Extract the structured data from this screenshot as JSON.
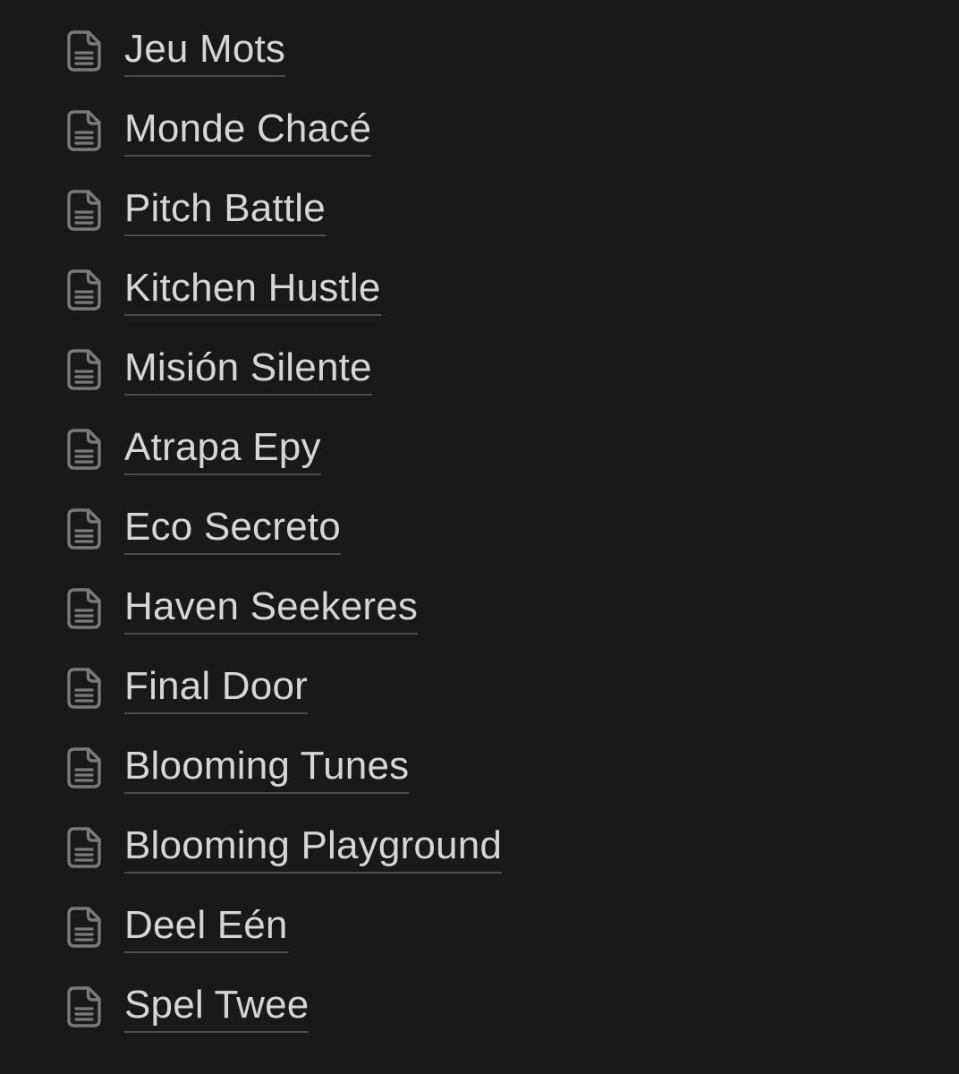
{
  "pages": [
    {
      "title": "Jeu Mots",
      "icon": "document-icon"
    },
    {
      "title": "Monde Chacé",
      "icon": "document-icon"
    },
    {
      "title": "Pitch Battle",
      "icon": "document-icon"
    },
    {
      "title": "Kitchen Hustle",
      "icon": "document-icon"
    },
    {
      "title": "Misión Silente",
      "icon": "document-icon"
    },
    {
      "title": "Atrapa Epy",
      "icon": "document-icon"
    },
    {
      "title": "Eco Secreto",
      "icon": "document-icon"
    },
    {
      "title": "Haven Seekeres",
      "icon": "document-icon"
    },
    {
      "title": "Final Door",
      "icon": "document-icon"
    },
    {
      "title": "Blooming Tunes",
      "icon": "document-icon"
    },
    {
      "title": "Blooming Playground",
      "icon": "document-icon"
    },
    {
      "title": "Deel Eén",
      "icon": "document-icon"
    },
    {
      "title": "Spel Twee",
      "icon": "document-icon"
    }
  ],
  "colors": {
    "background": "#191919",
    "text": "#d6d6d6",
    "icon": "#7a7a7a",
    "underline": "#4c4c4c"
  }
}
